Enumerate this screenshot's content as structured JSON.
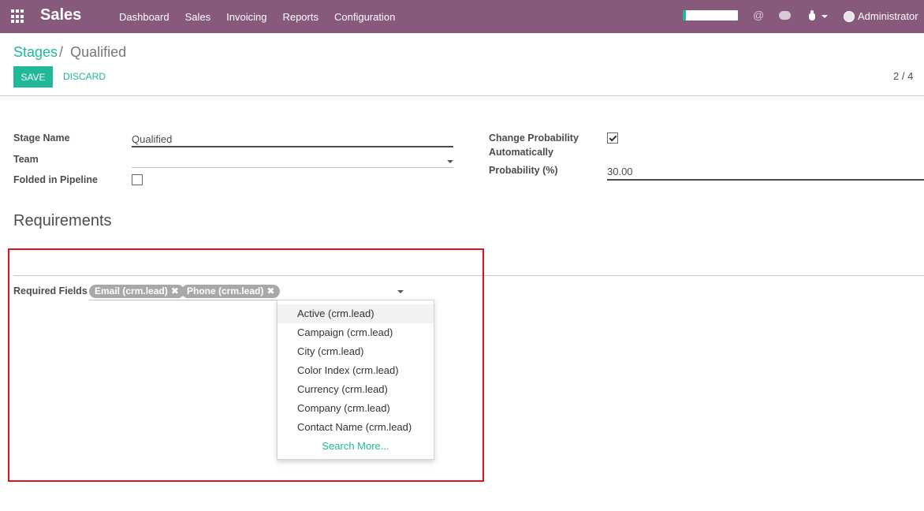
{
  "navbar": {
    "app_name": "Sales",
    "menu": [
      "Dashboard",
      "Sales",
      "Invoicing",
      "Reports",
      "Configuration"
    ],
    "progress_fraction": 0.06,
    "mention_symbol": "@",
    "user": "Administrator",
    "icons": [
      "apps-grid-icon",
      "at-icon",
      "chat-icon",
      "bug-icon",
      "avatar"
    ]
  },
  "breadcrumb": {
    "parent": "Stages",
    "separator": "/",
    "current": "Qualified"
  },
  "actions": {
    "save": "Save",
    "discard": "Discard"
  },
  "pager": "2 / 4",
  "form": {
    "stage_name_label": "Stage Name",
    "stage_name_value": "Qualified",
    "team_label": "Team",
    "team_value": "",
    "folded_label": "Folded in Pipeline",
    "folded_checked": false,
    "change_prob_label_1": "Change Probability",
    "change_prob_label_2": "Automatically",
    "change_prob_checked": true,
    "probability_label": "Probability (%)",
    "probability_value": "30.00"
  },
  "requirements": {
    "title": "Requirements",
    "required_fields_label": "Required Fields",
    "tags": [
      "Email (crm.lead)",
      "Phone (crm.lead)"
    ],
    "tag_remove_symbol": "✖",
    "dropdown_items": [
      "Active (crm.lead)",
      "Campaign (crm.lead)",
      "City (crm.lead)",
      "Color Index (crm.lead)",
      "Currency (crm.lead)",
      "Company (crm.lead)",
      "Contact Name (crm.lead)"
    ],
    "search_more": "Search More..."
  },
  "colors": {
    "navbar": "#875a7b",
    "accent": "#21b799",
    "highlight": "#e0101e"
  }
}
